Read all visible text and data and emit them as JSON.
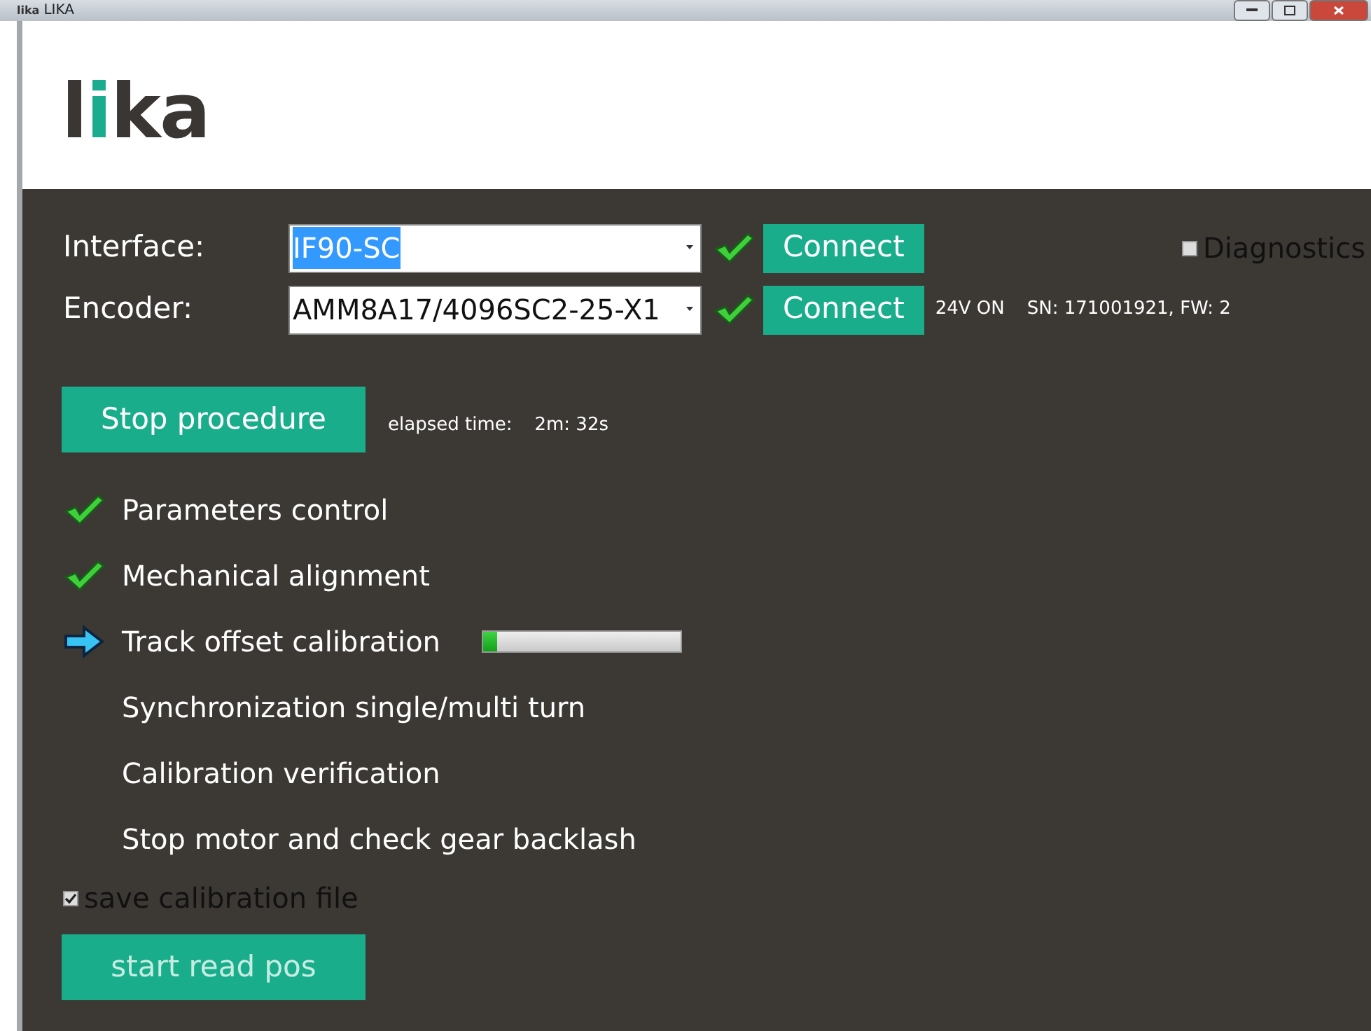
{
  "window": {
    "title": "LIKA",
    "icon_text": "lika"
  },
  "logo": "lika",
  "interface": {
    "label": "Interface:",
    "value": "IF90-SC",
    "value_selected": true,
    "connected": true,
    "button": "Connect"
  },
  "encoder": {
    "label": "Encoder:",
    "value": "AMM8A17/4096SC2-25-X1",
    "value_selected": false,
    "connected": true,
    "button": "Connect",
    "power": "24V ON",
    "info": "SN: 171001921, FW: 2"
  },
  "diagnostics": {
    "label": "Diagnostics",
    "checked": false
  },
  "procedure": {
    "button": "Stop procedure",
    "elapsed_label": "elapsed time:",
    "elapsed": "2m: 32s"
  },
  "steps": [
    {
      "label": "Parameters control",
      "kind": "done"
    },
    {
      "label": "Mechanical alignment",
      "kind": "done"
    },
    {
      "label": "Track offset calibration",
      "kind": "current",
      "level": 0.07
    },
    {
      "label": "Synchronization single/multi turn",
      "kind": "pending"
    },
    {
      "label": "Calibration verification",
      "kind": "pending"
    },
    {
      "label": "Stop motor and check gear backlash",
      "kind": "pending"
    }
  ],
  "save_file": {
    "label": "save calibration file",
    "checked": true
  },
  "read_button": {
    "label": "start read pos",
    "disabled": true
  }
}
